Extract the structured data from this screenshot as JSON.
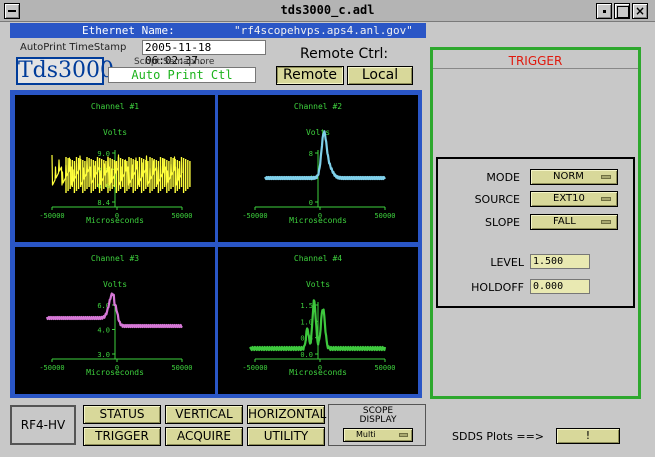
{
  "window": {
    "title": "tds3000_c.adl"
  },
  "header": {
    "ethernet_label": "Ethernet Name:",
    "ethernet_value": "\"rf4scopehvps.aps4.anl.gov\"",
    "autoprint_label": "AutoPrint TimeStamp",
    "autoprint_value": "2005-11-18 06:02:37.",
    "logo": "Tds3000",
    "semaphore_label": "Script Semaphore",
    "semaphore_value": "Auto Print Ctl",
    "remote_ctrl_label": "Remote Ctrl:",
    "remote_btn": "Remote",
    "local_btn": "Local"
  },
  "channels": [
    {
      "title": "Channel #1",
      "ylabel": "Volts",
      "xlabel": "Microseconds",
      "x_ticks": [
        "-50000",
        "0",
        "50000"
      ],
      "y_ticks": [
        "9.0",
        "8.8",
        "8.6",
        "8.4"
      ],
      "color": "#ffff3c"
    },
    {
      "title": "Channel #2",
      "ylabel": "Volts",
      "xlabel": "Microseconds",
      "x_ticks": [
        "-50000",
        "0",
        "50000"
      ],
      "y_ticks": [
        "8",
        "4",
        "0"
      ],
      "color": "#7fd0ea"
    },
    {
      "title": "Channel #3",
      "ylabel": "Volts",
      "xlabel": "Microseconds",
      "x_ticks": [
        "-50000",
        "0",
        "50000"
      ],
      "y_ticks": [
        "6.0",
        "4.0",
        "3.0"
      ],
      "color": "#d678d6"
    },
    {
      "title": "Channel #4",
      "ylabel": "Volts",
      "xlabel": "Microseconds",
      "x_ticks": [
        "-50000",
        "0",
        "50000"
      ],
      "y_ticks": [
        "1.5",
        "1.0",
        "0.5",
        "0.0"
      ],
      "color": "#3ec83e"
    }
  ],
  "trigger": {
    "title": "TRIGGER",
    "mode_label": "MODE",
    "mode_value": "NORM",
    "source_label": "SOURCE",
    "source_value": "EXT10",
    "slope_label": "SLOPE",
    "slope_value": "FALL",
    "level_label": "LEVEL",
    "level_value": "1.500",
    "holdoff_label": "HOLDOFF",
    "holdoff_value": "0.000"
  },
  "bottom": {
    "rf_label": "RF4-HV",
    "status": "STATUS",
    "vertical": "VERTICAL",
    "horizontal": "HORIZONTAL",
    "trigger": "TRIGGER",
    "acquire": "ACQUIRE",
    "utility": "UTILITY",
    "scope_display_line1": "SCOPE",
    "scope_display_line2": "DISPLAY",
    "scope_display_value": "Multi",
    "sdds_label": "SDDS Plots ==>",
    "sdds_btn": "!"
  }
}
